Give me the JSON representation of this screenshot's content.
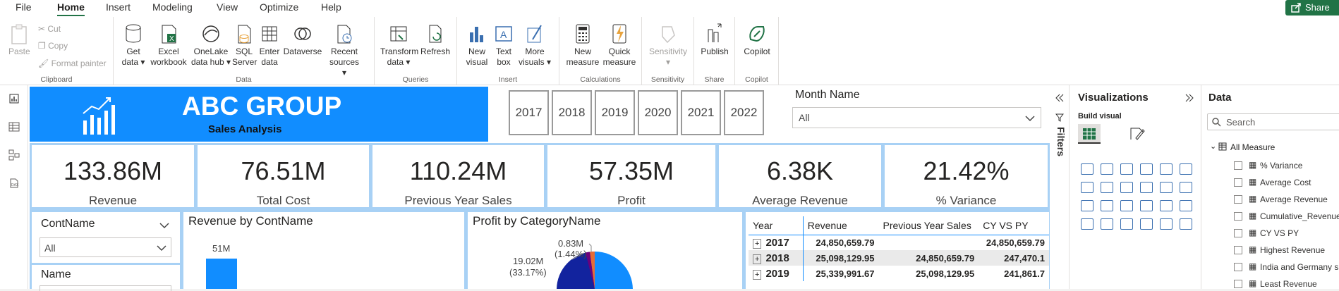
{
  "menu": {
    "tabs": [
      "File",
      "Home",
      "Insert",
      "Modeling",
      "View",
      "Optimize",
      "Help"
    ],
    "active": "Home",
    "share": "Share"
  },
  "ribbon": {
    "clipboard": {
      "paste": "Paste",
      "cut": "Cut",
      "copy": "Copy",
      "format_painter": "Format painter",
      "label": "Clipboard"
    },
    "data": {
      "get_data": "Get data",
      "excel": "Excel workbook",
      "onelake": "OneLake data hub",
      "sql": "SQL Server",
      "enter": "Enter data",
      "dataverse": "Dataverse",
      "recent": "Recent sources",
      "label": "Data"
    },
    "queries": {
      "transform": "Transform data",
      "refresh": "Refresh",
      "label": "Queries"
    },
    "insert": {
      "new_visual": "New visual",
      "text_box": "Text box",
      "more_visuals": "More visuals",
      "label": "Insert"
    },
    "calculations": {
      "new_measure": "New measure",
      "quick_measure": "Quick measure",
      "label": "Calculations"
    },
    "sensitivity": {
      "btn": "Sensitivity",
      "label": "Sensitivity"
    },
    "share": {
      "publish": "Publish",
      "label": "Share"
    },
    "copilot": {
      "btn": "Copilot",
      "label": "Copilot"
    }
  },
  "report": {
    "title": "ABC GROUP",
    "subtitle": "Sales Analysis",
    "years": [
      "2017",
      "2018",
      "2019",
      "2020",
      "2021",
      "2022"
    ],
    "month_filter": {
      "label": "Month Name",
      "value": "All"
    },
    "kpis": [
      {
        "value": "133.86M",
        "label": "Revenue"
      },
      {
        "value": "76.51M",
        "label": "Total Cost"
      },
      {
        "value": "110.24M",
        "label": "Previous Year Sales"
      },
      {
        "value": "57.35M",
        "label": "Profit"
      },
      {
        "value": "6.38K",
        "label": "Average Revenue"
      },
      {
        "value": "21.42%",
        "label": "% Variance"
      }
    ],
    "slicers": {
      "cont_label": "ContName",
      "cont_value": "All",
      "name_label": "Name"
    },
    "revenue_chart": {
      "title": "Revenue by ContName",
      "bar_label": "51M"
    },
    "profit_chart": {
      "title": "Profit by CategoryName",
      "label1": "0.83M",
      "label1b": "(1.44%)",
      "label2": "19.02M",
      "label2b": "(33.17%)"
    },
    "table": {
      "headers": [
        "Year",
        "Revenue",
        "Previous Year Sales",
        "CY VS PY"
      ],
      "rows": [
        [
          "2017",
          "24,850,659.79",
          "",
          "24,850,659.79"
        ],
        [
          "2018",
          "25,098,129.95",
          "24,850,659.79",
          "247,470.1"
        ],
        [
          "2019",
          "25,339,991.67",
          "25,098,129.95",
          "241,861.7"
        ]
      ]
    }
  },
  "panes": {
    "filters": "Filters",
    "viz_title": "Visualizations",
    "build_visual": "Build visual",
    "data_title": "Data",
    "search_placeholder": "Search",
    "table_name": "All Measure",
    "fields": [
      "% Variance",
      "Average Cost",
      "Average Revenue",
      "Cumulative_Revenue",
      "CY VS PY",
      "Highest Revenue",
      "India and Germany s...",
      "Least Revenue"
    ]
  },
  "chart_data": [
    {
      "type": "bar",
      "title": "Revenue by ContName",
      "data_labels": [
        "51M"
      ]
    },
    {
      "type": "pie",
      "title": "Profit by CategoryName",
      "slices": [
        {
          "value_label": "0.83M",
          "percent": 1.44
        },
        {
          "value_label": "19.02M",
          "percent": 33.17
        }
      ]
    }
  ],
  "colors": {
    "accent": "#118dff",
    "brand": "#217346",
    "pie_dark": "#12239e",
    "pie_red": "#e66c37"
  }
}
